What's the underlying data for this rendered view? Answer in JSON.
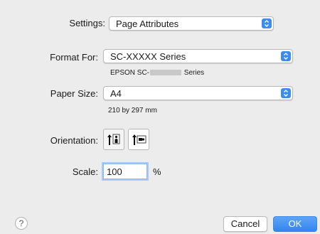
{
  "dialog": {
    "settings": {
      "label": "Settings:",
      "value": "Page Attributes"
    },
    "format_for": {
      "label": "Format For:",
      "value": "SC-XXXXX Series",
      "desc_prefix": "EPSON SC-",
      "desc_suffix": "Series"
    },
    "paper_size": {
      "label": "Paper Size:",
      "value": "A4",
      "desc": "210 by 297 mm"
    },
    "orientation": {
      "label": "Orientation:",
      "options": [
        "portrait",
        "landscape"
      ],
      "selected": "portrait"
    },
    "scale": {
      "label": "Scale:",
      "value": "100",
      "unit": "%"
    },
    "buttons": {
      "help": "?",
      "cancel": "Cancel",
      "ok": "OK"
    },
    "colors": {
      "accent": "#3b8cf0",
      "background": "#ececec"
    },
    "icons": {
      "popup": "up-down-arrows-icon",
      "portrait": "portrait-orientation-icon",
      "landscape": "landscape-orientation-icon",
      "help": "help-icon"
    }
  }
}
